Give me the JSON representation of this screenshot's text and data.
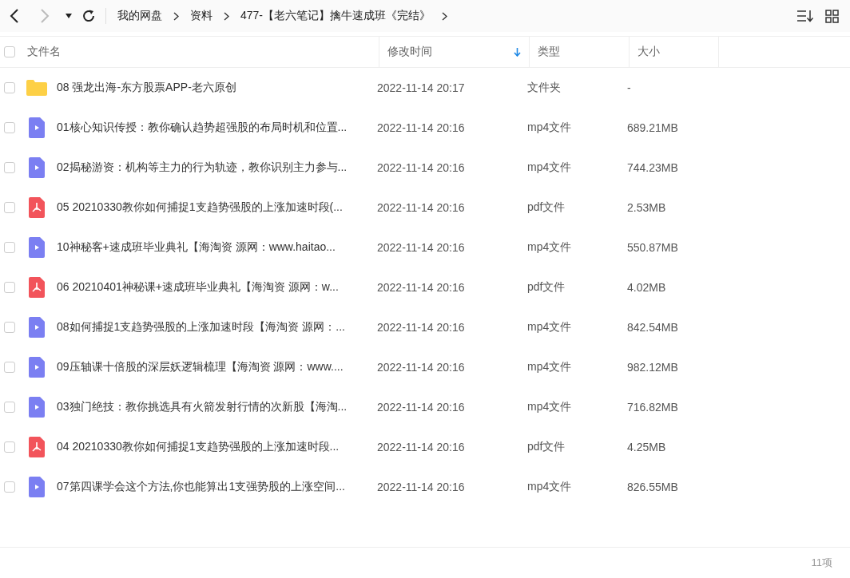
{
  "toolbar": {
    "back_disabled": false,
    "forward_disabled": true
  },
  "breadcrumbs": [
    "我的网盘",
    "资料",
    "477-【老六笔记】擒牛速成班《完结》"
  ],
  "select_all_checked": false,
  "columns": [
    {
      "label": "文件名",
      "sorted": false
    },
    {
      "label": "修改时间",
      "sorted": true
    },
    {
      "label": "类型",
      "sorted": false
    },
    {
      "label": "大小",
      "sorted": false
    }
  ],
  "files": [
    {
      "name": "08 强龙出海-东方股票APP-老六原创",
      "modified": "2022-11-14 20:17",
      "type": "文件夹",
      "size": "-",
      "kind": "folder",
      "checked": false
    },
    {
      "name": "01核心知识传授：教你确认趋势超强股的布局时机和位置...",
      "modified": "2022-11-14 20:16",
      "type": "mp4文件",
      "size": "689.21MB",
      "kind": "video",
      "checked": false
    },
    {
      "name": "02揭秘游资：机构等主力的行为轨迹，教你识别主力参与...",
      "modified": "2022-11-14 20:16",
      "type": "mp4文件",
      "size": "744.23MB",
      "kind": "video",
      "checked": false
    },
    {
      "name": "05 20210330教你如何捕捉1支趋势强股的上涨加速时段(...",
      "modified": "2022-11-14 20:16",
      "type": "pdf文件",
      "size": "2.53MB",
      "kind": "pdf",
      "checked": false
    },
    {
      "name": "10神秘客+速成班毕业典礼【海淘资 源网：www.haitao...",
      "modified": "2022-11-14 20:16",
      "type": "mp4文件",
      "size": "550.87MB",
      "kind": "video",
      "checked": false
    },
    {
      "name": "06 20210401神秘课+速成班毕业典礼【海淘资 源网：w...",
      "modified": "2022-11-14 20:16",
      "type": "pdf文件",
      "size": "4.02MB",
      "kind": "pdf",
      "checked": false
    },
    {
      "name": "08如何捕捉1支趋势强股的上涨加速时段【海淘资 源网：...",
      "modified": "2022-11-14 20:16",
      "type": "mp4文件",
      "size": "842.54MB",
      "kind": "video",
      "checked": false
    },
    {
      "name": "09压轴课十倍股的深层妖逻辑梳理【海淘资 源网：www....",
      "modified": "2022-11-14 20:16",
      "type": "mp4文件",
      "size": "982.12MB",
      "kind": "video",
      "checked": false
    },
    {
      "name": "03独门绝技：教你挑选具有火箭发射行情的次新股【海淘...",
      "modified": "2022-11-14 20:16",
      "type": "mp4文件",
      "size": "716.82MB",
      "kind": "video",
      "checked": false
    },
    {
      "name": "04 20210330教你如何捕捉1支趋势强股的上涨加速时段...",
      "modified": "2022-11-14 20:16",
      "type": "pdf文件",
      "size": "4.25MB",
      "kind": "pdf",
      "checked": false
    },
    {
      "name": "07第四课学会这个方法,你也能算出1支强势股的上涨空间...",
      "modified": "2022-11-14 20:16",
      "type": "mp4文件",
      "size": "826.55MB",
      "kind": "video",
      "checked": false
    }
  ],
  "footer": {
    "count": "11项"
  }
}
